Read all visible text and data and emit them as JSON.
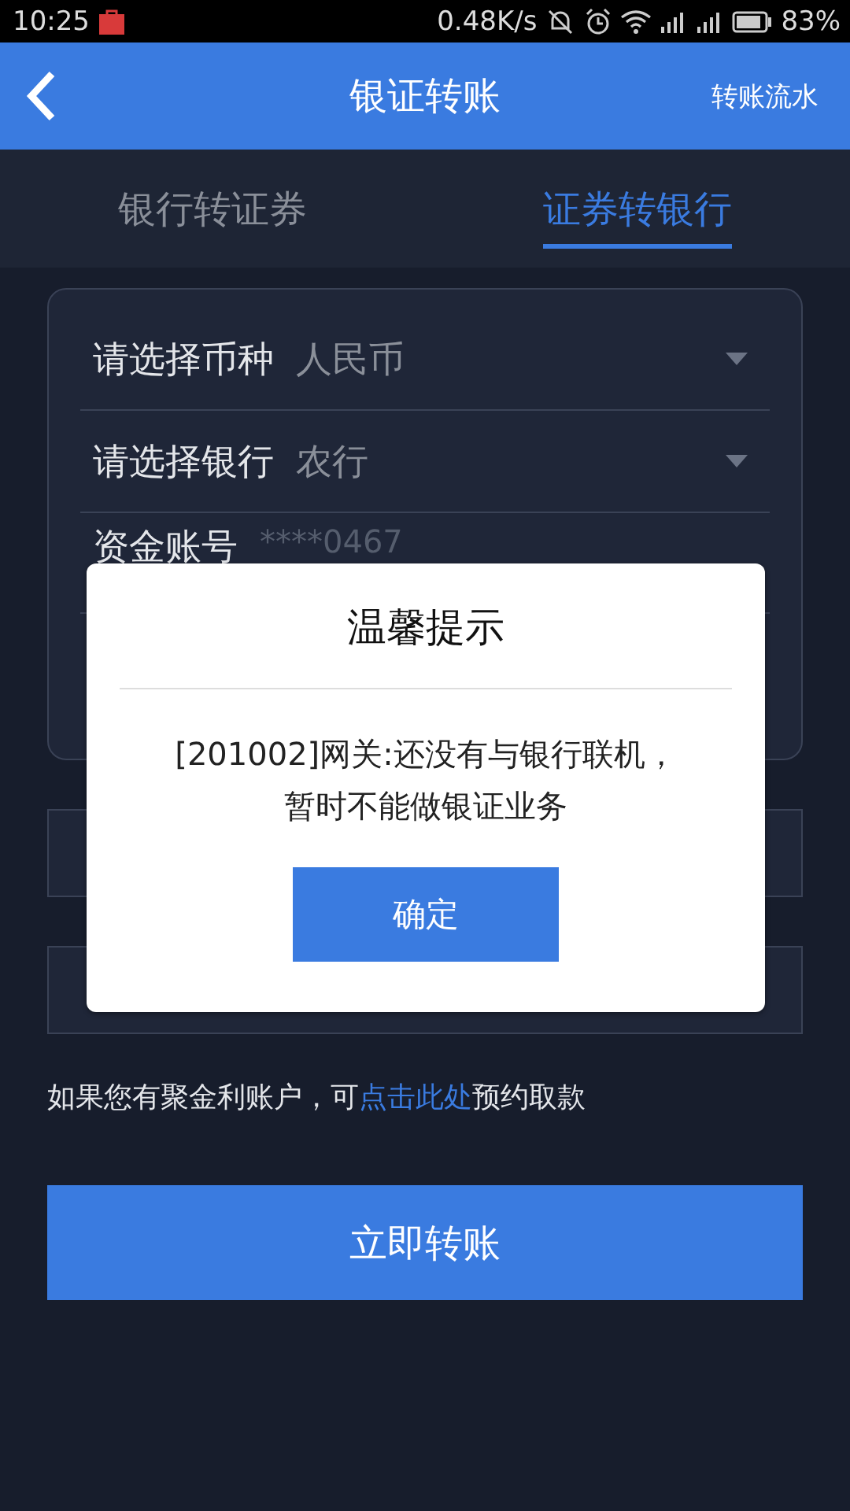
{
  "status_bar": {
    "time": "10:25",
    "speed": "0.48K/s",
    "battery": "83%"
  },
  "header": {
    "title": "银证转账",
    "action": "转账流水"
  },
  "tabs": [
    {
      "label": "银行转证券",
      "selected": false
    },
    {
      "label": "证券转银行",
      "selected": true
    }
  ],
  "form": {
    "rows": [
      {
        "kind": "select",
        "label": "请选择币种",
        "value": "人民币"
      },
      {
        "kind": "select",
        "label": "请选择银行",
        "value": "农行"
      },
      {
        "kind": "text",
        "label": "资金账号",
        "value": "****0467"
      },
      {
        "kind": "empty"
      }
    ]
  },
  "note": {
    "prefix": "如果您有聚金利账户，可",
    "link": "点击此处",
    "suffix": "预约取款"
  },
  "submit": "立即转账",
  "dialog": {
    "title": "温馨提示",
    "message": "[201002]网关:还没有与银行联机，暂时不能做银证业务",
    "button": "确定"
  }
}
